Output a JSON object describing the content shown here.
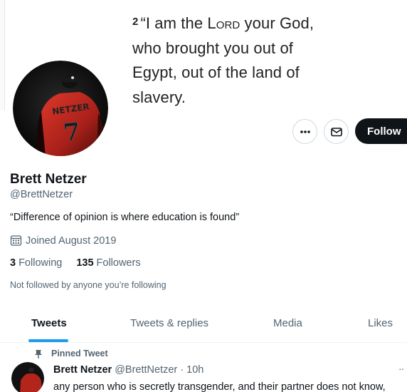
{
  "banner": {
    "verse_number": "2",
    "verse_line1_pre": "“I am the ",
    "verse_lord": "Lord",
    "verse_line1_post": " your God,",
    "verse_line2": "who brought you out of",
    "verse_line3": "Egypt, out of the land of",
    "verse_line4": "slavery."
  },
  "avatar": {
    "jersey_name": "NETZER",
    "jersey_number": "7"
  },
  "actions": {
    "more_icon": "more-horizontal-icon",
    "message_icon": "envelope-icon",
    "follow_label": "Follow"
  },
  "profile": {
    "name": "Brett Netzer",
    "handle": "@BrettNetzer",
    "bio": "“Difference of opinion is where education is found”",
    "joined": "Joined August 2019",
    "following_count": "3",
    "following_label": "Following",
    "followers_count": "135",
    "followers_label": "Followers",
    "not_followed": "Not followed by anyone you’re following"
  },
  "tabs": [
    {
      "label": "Tweets",
      "active": true
    },
    {
      "label": "Tweets & replies",
      "active": false
    },
    {
      "label": "Media",
      "active": false
    },
    {
      "label": "Likes",
      "active": false
    }
  ],
  "pinned_tweet": {
    "pinned_label": "Pinned Tweet",
    "author_name": "Brett Netzer",
    "author_handle": "@BrettNetzer",
    "separator": "·",
    "time": "10h",
    "more": "··",
    "text": "any person who is secretly transgender, and their partner does not know,"
  },
  "colors": {
    "accent": "#1d9bf0",
    "follow_bg": "#0f1419",
    "muted_text": "#536471",
    "jersey_red": "#c0281e"
  }
}
